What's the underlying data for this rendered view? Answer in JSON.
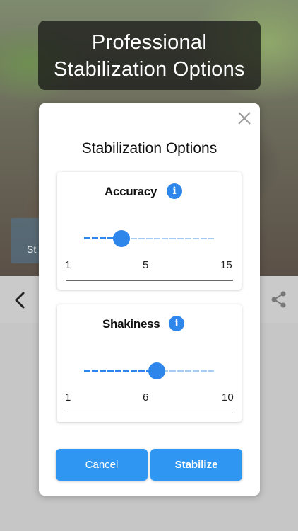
{
  "banner": {
    "title_line1": "Professional",
    "title_line2": "Stabilization Options"
  },
  "background": {
    "chip_text": "St"
  },
  "dialog": {
    "title": "Stabilization Options",
    "accuracy": {
      "label": "Accuracy",
      "min": "1",
      "value": "5",
      "max": "15",
      "fill_fraction": 0.29
    },
    "shakiness": {
      "label": "Shakiness",
      "min": "1",
      "value": "6",
      "max": "10",
      "fill_fraction": 0.56
    },
    "cancel_label": "Cancel",
    "stabilize_label": "Stabilize"
  },
  "colors": {
    "accent": "#2f86ea",
    "button": "#2f97f2"
  },
  "icons": [
    "close-icon",
    "info-icon",
    "back-arrow-icon",
    "share-icon"
  ]
}
